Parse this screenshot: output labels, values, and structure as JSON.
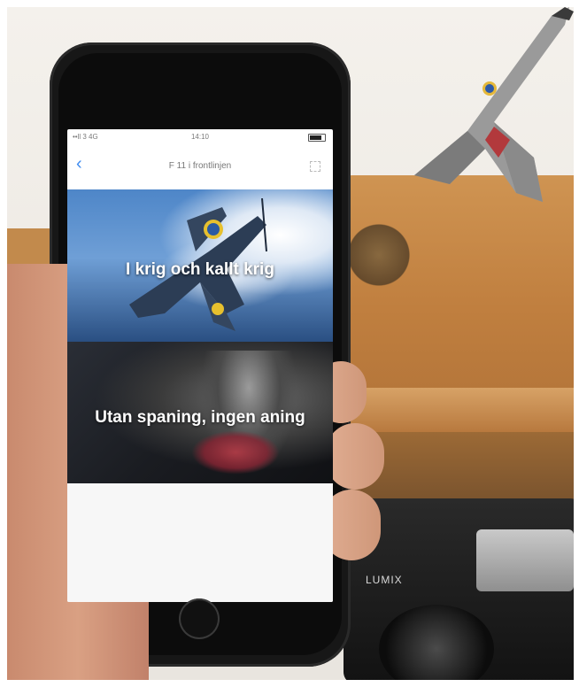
{
  "status_bar": {
    "carrier": "••ll 3 4G",
    "time": "14:10"
  },
  "nav": {
    "title": "F 11 i frontlinjen"
  },
  "cards": [
    {
      "label": "I krig och kallt krig"
    },
    {
      "label": "Utan spaning, ingen aning"
    },
    {
      "label": ""
    }
  ],
  "camera_brand": "LUMIX",
  "icons": [
    "back-chevron-icon",
    "fullscreen-icon",
    "battery-icon",
    "home-button"
  ]
}
